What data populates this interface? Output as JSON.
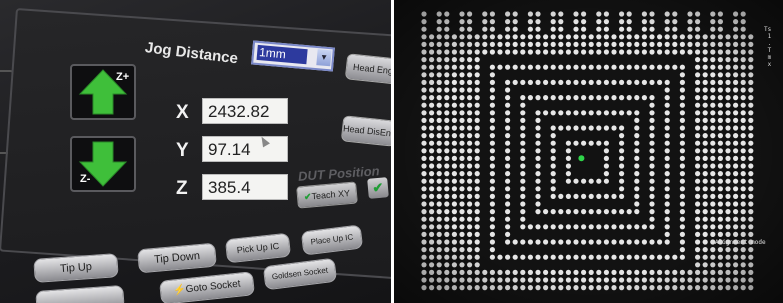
{
  "left_panel": {
    "jog_distance": {
      "label": "Jog Distance",
      "selected": "1mm"
    },
    "arrows": {
      "up_label": "Z+",
      "down_label": "Z-"
    },
    "axes": [
      {
        "label": "X",
        "value": "2432.82"
      },
      {
        "label": "Y",
        "value": "97.14"
      },
      {
        "label": "Z",
        "value": "385.4"
      }
    ],
    "side_buttons": {
      "head_eng": "Head Eng",
      "head_disengage": "Head DisEng"
    },
    "dut_position": {
      "label": "DUT Position",
      "teach_xy": "Teach XY"
    },
    "bottom_buttons": {
      "tip_up": "Tip Up",
      "tip_down": "Tip Down",
      "pick_up_ic": "Pick Up IC",
      "place_up_ic": "Place Up IC",
      "goto_socket": "Goto Socket",
      "goldsen_socket": "Goldsen Socket"
    },
    "colors": {
      "arrow_green": "#3fbf3a",
      "teach_check": "#1f9e35"
    }
  },
  "right_panel": {
    "status_text": "Alignment mode",
    "marker_color": "#2fd44a",
    "side_text_color": "#d6d6d6"
  }
}
